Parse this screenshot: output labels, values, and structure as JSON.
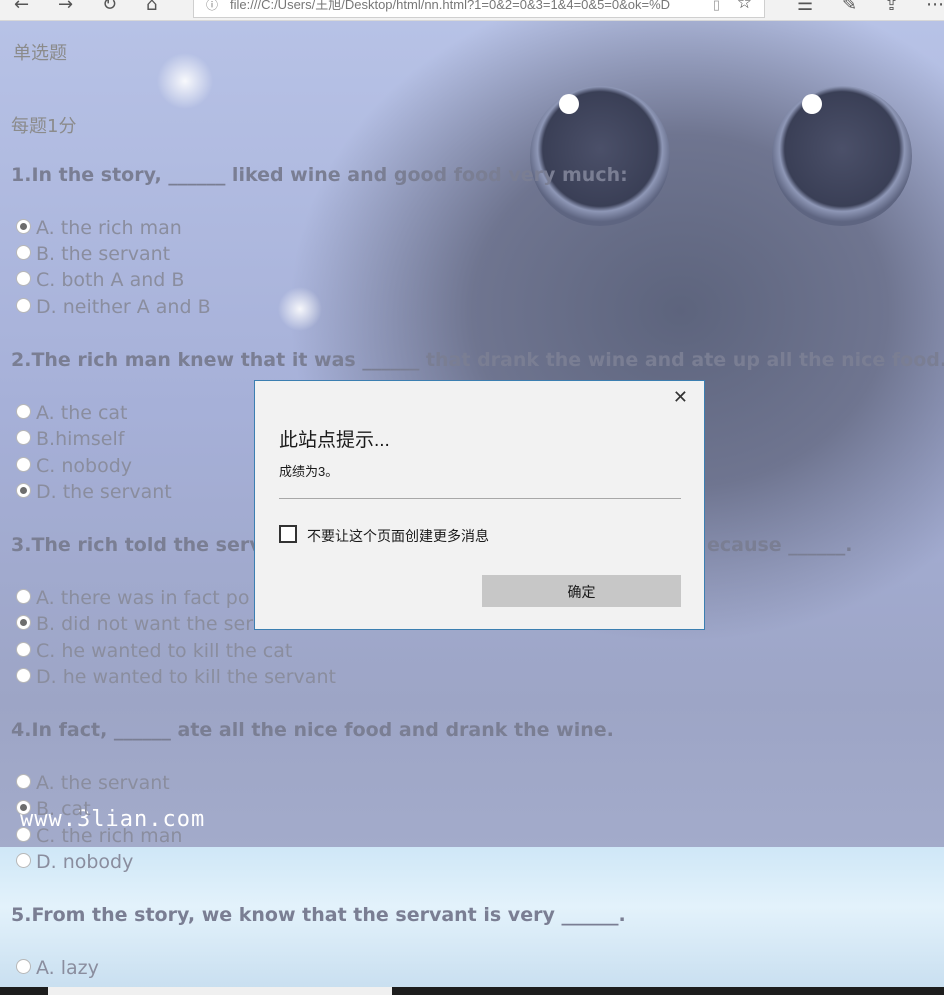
{
  "browser": {
    "address": "file:///C:/Users/王旭/Desktop/html/nn.html?1=0&2=0&3=1&4=0&5=0&ok=%D"
  },
  "page": {
    "section_title": "单选题",
    "score_note": "每题1分",
    "watermark": "www.3lian.com",
    "questions": [
      {
        "title": "1.In the story, ______ liked wine and good food very much:",
        "options": [
          {
            "label": "A. the rich man",
            "checked": true
          },
          {
            "label": "B. the servant",
            "checked": false
          },
          {
            "label": "C. both A and B",
            "checked": false
          },
          {
            "label": "D. neither A and B",
            "checked": false
          }
        ]
      },
      {
        "title": "2.The rich man knew that it was ______ that drank the wine and ate up all the nice food.",
        "options": [
          {
            "label": "A. the cat",
            "checked": false
          },
          {
            "label": "B.himself",
            "checked": false
          },
          {
            "label": "C. nobody",
            "checked": false
          },
          {
            "label": "D. the servant",
            "checked": true
          }
        ]
      },
      {
        "title": "3.The rich told the serva",
        "title_tail": "ecause ______.",
        "options": [
          {
            "label": "A. there was in fact po",
            "checked": false
          },
          {
            "label": "B. did not want the ser",
            "checked": true
          },
          {
            "label": "C. he wanted to kill the cat",
            "checked": false
          },
          {
            "label": "D. he wanted to kill the servant",
            "checked": false
          }
        ]
      },
      {
        "title": "4.In fact, ______ ate all the nice food and drank the wine.",
        "options": [
          {
            "label": "A. the servant",
            "checked": false
          },
          {
            "label": "B. cat",
            "checked": true
          },
          {
            "label": "C. the rich man",
            "checked": false
          },
          {
            "label": "D. nobody",
            "checked": false
          }
        ]
      },
      {
        "title": "5.From the story, we know that the servant is very ______.",
        "options": [
          {
            "label": "A. lazy",
            "checked": false
          }
        ]
      }
    ]
  },
  "dialog": {
    "title": "此站点提示...",
    "message": "成绩为3。",
    "checkbox_label": "不要让这个页面创建更多消息",
    "ok_label": "确定"
  }
}
